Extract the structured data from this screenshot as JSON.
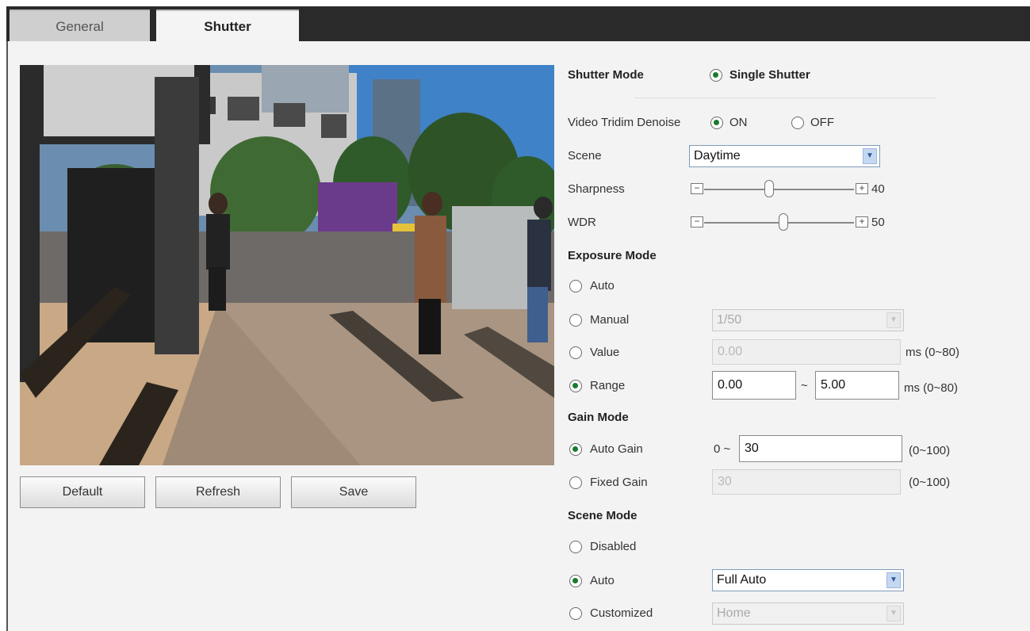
{
  "tabs": {
    "general": "General",
    "shutter": "Shutter"
  },
  "buttons": {
    "default": "Default",
    "refresh": "Refresh",
    "save": "Save"
  },
  "shutter_mode": {
    "label": "Shutter Mode",
    "option": "Single Shutter"
  },
  "denoise": {
    "label": "Video Tridim Denoise",
    "on": "ON",
    "off": "OFF"
  },
  "scene": {
    "label": "Scene",
    "value": "Daytime"
  },
  "sharpness": {
    "label": "Sharpness",
    "value": "40"
  },
  "wdr": {
    "label": "WDR",
    "value": "50"
  },
  "exposure": {
    "title": "Exposure Mode",
    "auto": "Auto",
    "manual": "Manual",
    "manual_value": "1/50",
    "value": "Value",
    "value_input": "0.00",
    "value_range": "ms (0~80)",
    "range": "Range",
    "range_min": "0.00",
    "range_sep": "~",
    "range_max": "5.00",
    "range_unit": "ms (0~80)"
  },
  "gain": {
    "title": "Gain Mode",
    "auto": "Auto Gain",
    "auto_prefix": "0 ~",
    "auto_value": "30",
    "auto_range": "(0~100)",
    "fixed": "Fixed Gain",
    "fixed_value": "30",
    "fixed_range": "(0~100)"
  },
  "scene_mode": {
    "title": "Scene Mode",
    "disabled": "Disabled",
    "auto": "Auto",
    "auto_value": "Full Auto",
    "customized": "Customized",
    "customized_value": "Home"
  },
  "colors": {
    "selected_radio": "#1a7a2e",
    "topbar": "#2a2a2a",
    "panel": "#f3f3f3"
  }
}
